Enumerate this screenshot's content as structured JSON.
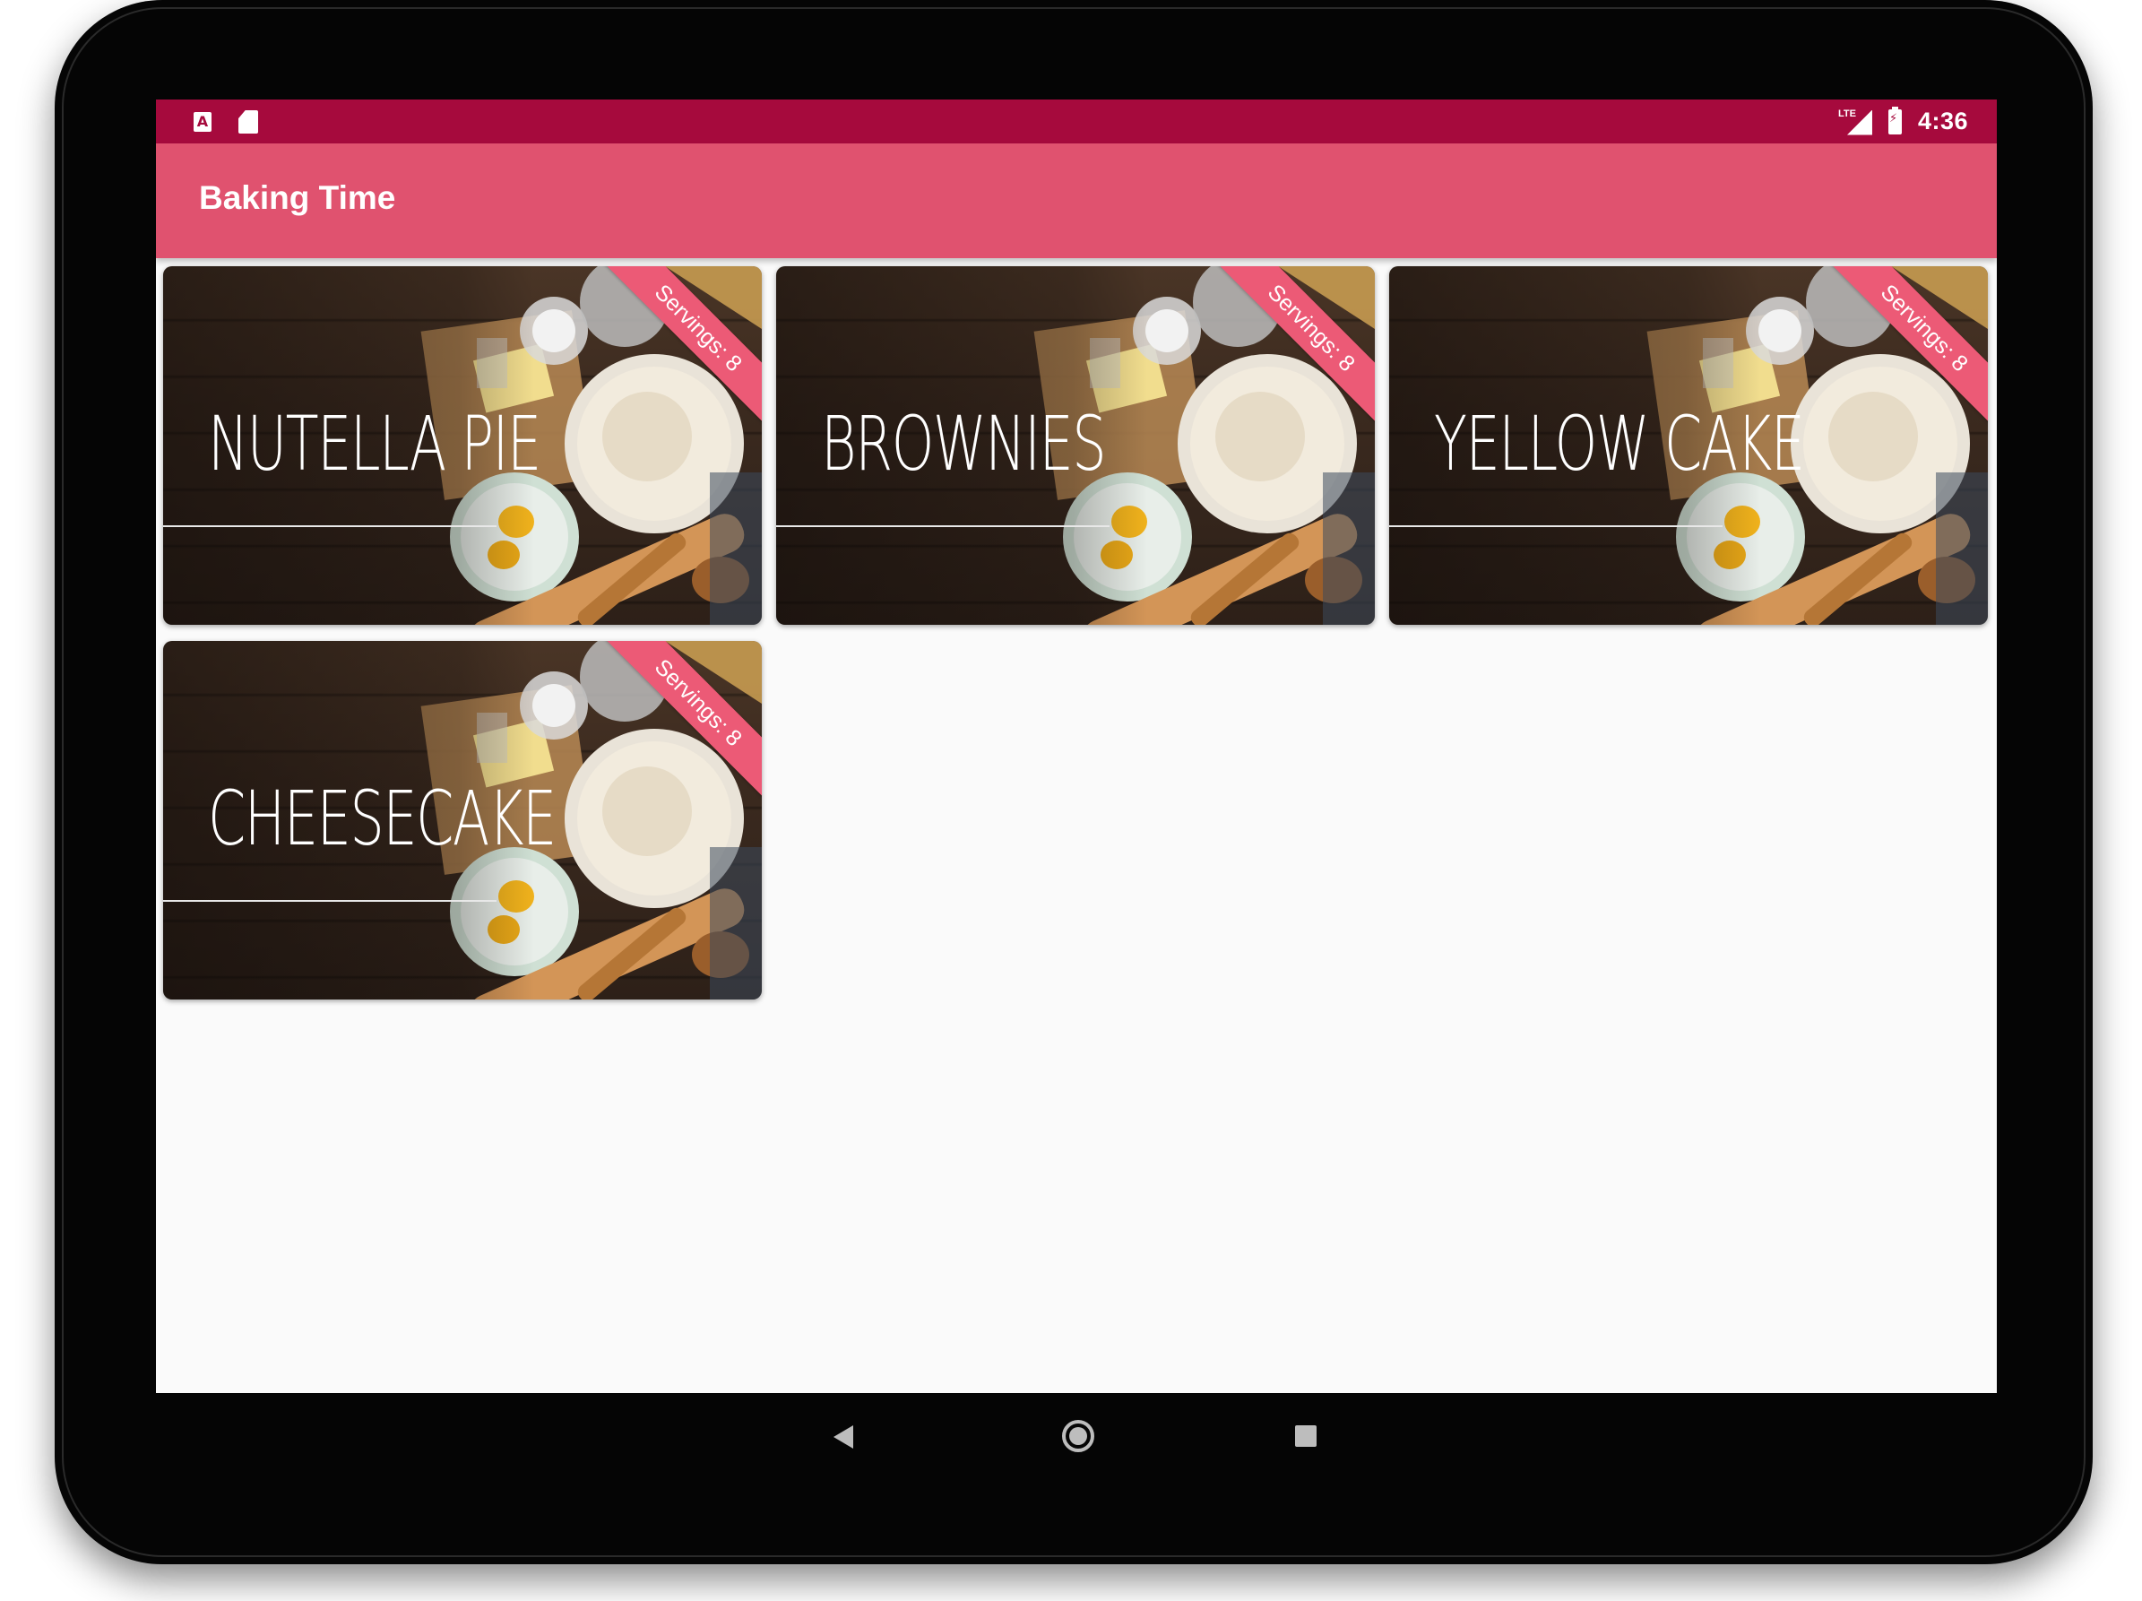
{
  "status_bar": {
    "left_icons": [
      "text-a-icon",
      "sd-card-icon"
    ],
    "network_label": "LTE",
    "right_icons": [
      "signal-icon",
      "battery-charging-icon"
    ],
    "time": "4:36"
  },
  "app_bar": {
    "title": "Baking Time"
  },
  "recipes": [
    {
      "name": "NUTELLA PIE",
      "servings": "Servings: 8"
    },
    {
      "name": "BROWNIES",
      "servings": "Servings: 8"
    },
    {
      "name": "YELLOW CAKE",
      "servings": "Servings: 8"
    },
    {
      "name": "CHEESECAKE",
      "servings": "Servings: 8"
    }
  ],
  "nav_bar": {
    "icons": [
      "back-icon",
      "home-icon",
      "recents-icon"
    ]
  },
  "colors": {
    "status_bar": "#a60a3d",
    "app_bar": "#e0526f",
    "ribbon": "#ec5a76",
    "background": "#fafafa"
  }
}
